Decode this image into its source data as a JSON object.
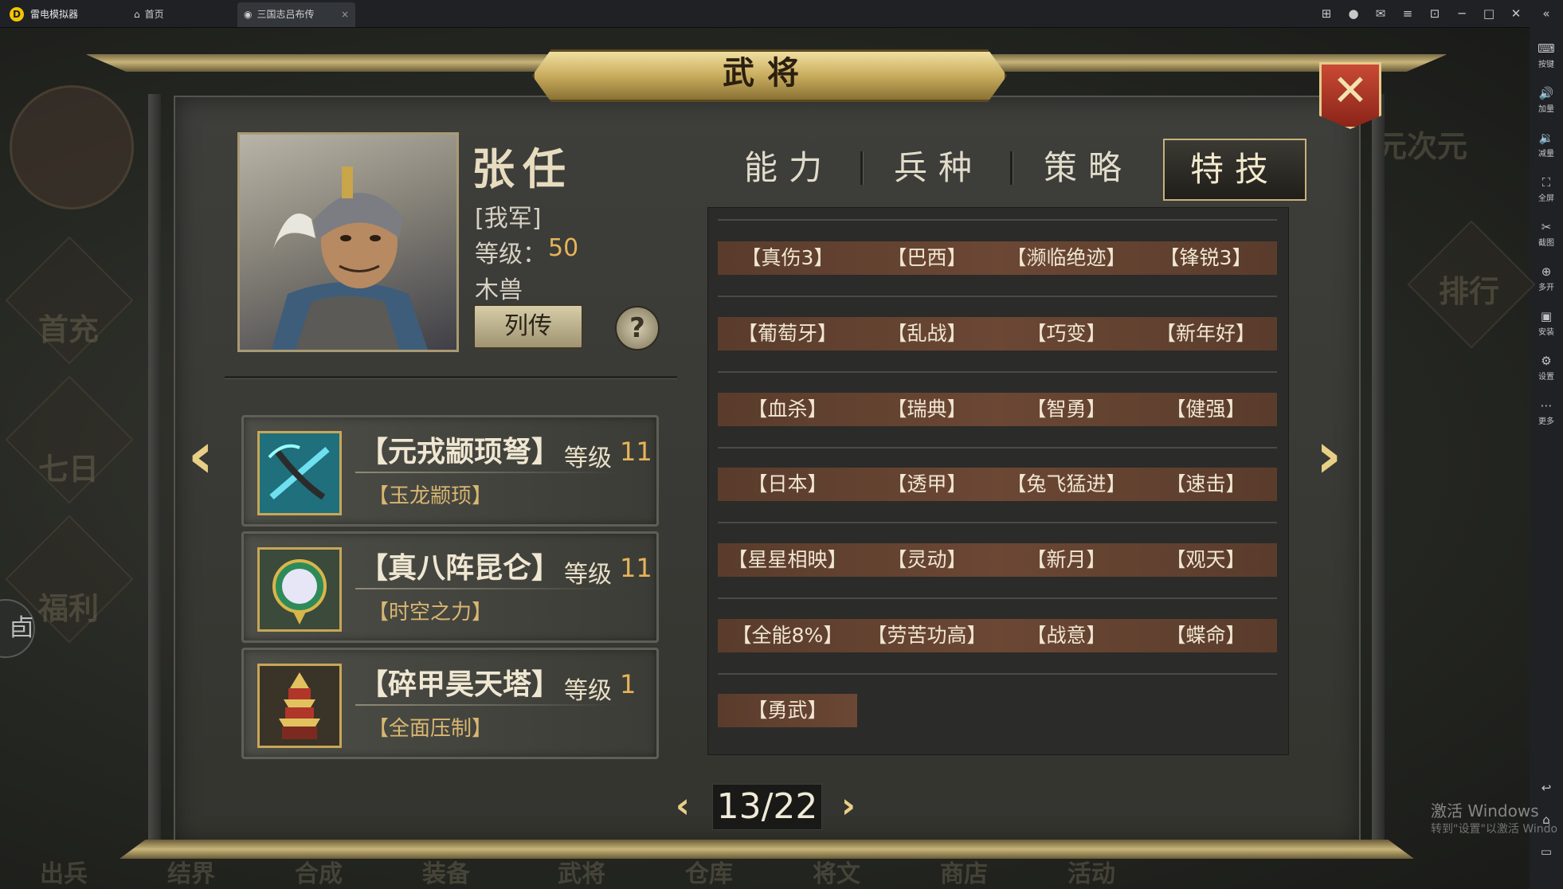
{
  "emulator": {
    "app_name": "雷电模拟器",
    "tabs": [
      {
        "label": "首页"
      },
      {
        "label": "三国志吕布传",
        "close": "×"
      }
    ],
    "sidebar": [
      {
        "icon": "keyboard-icon",
        "label": "按键"
      },
      {
        "icon": "volume-up-icon",
        "label": "加量"
      },
      {
        "icon": "volume-down-icon",
        "label": "减量"
      },
      {
        "icon": "fullscreen-icon",
        "label": "全屏"
      },
      {
        "icon": "scissors-icon",
        "label": "截图"
      },
      {
        "icon": "multi-open-icon",
        "label": "多开"
      },
      {
        "icon": "apk-install-icon",
        "label": "安装"
      },
      {
        "icon": "gear-icon",
        "label": "设置"
      },
      {
        "icon": "more-icon",
        "label": "更多"
      }
    ]
  },
  "background": {
    "left_menu": [
      "首充",
      "七日",
      "福利"
    ],
    "right_menu": [
      "元次元",
      "排行"
    ],
    "bottom_menu": [
      "出兵",
      "结界",
      "合成",
      "装备",
      "武将",
      "仓库",
      "将文",
      "商店",
      "活动"
    ]
  },
  "panel": {
    "title": "武将",
    "close_label": "✕"
  },
  "hero": {
    "name": "张任",
    "faction": "[我军]",
    "level_label": "等级：",
    "level_value": "50",
    "race": "木兽",
    "bio_button": "列传",
    "help_button": "?"
  },
  "equipment": [
    {
      "name": "【元戎颛顼弩】",
      "level_label": "等级",
      "level": "11",
      "skill": "【玉龙颛顼】",
      "icon": "crossbow-icon"
    },
    {
      "name": "【真八阵昆仑】",
      "level_label": "等级",
      "level": "11",
      "skill": "【时空之力】",
      "icon": "mirror-orb-icon"
    },
    {
      "name": "【碎甲昊天塔】",
      "level_label": "等级",
      "level": "1",
      "skill": "【全面压制】",
      "icon": "pagoda-icon"
    }
  ],
  "tabs": [
    {
      "label": "能力",
      "active": false
    },
    {
      "label": "兵种",
      "active": false
    },
    {
      "label": "策略",
      "active": false
    },
    {
      "label": "特技",
      "active": true
    }
  ],
  "skills": [
    [
      "【真伤3】",
      "【巴西】",
      "【濒临绝迹】",
      "【锋锐3】"
    ],
    [
      "【葡萄牙】",
      "【乱战】",
      "【巧变】",
      "【新年好】"
    ],
    [
      "【血杀】",
      "【瑞典】",
      "【智勇】",
      "【健强】"
    ],
    [
      "【日本】",
      "【透甲】",
      "【兔飞猛进】",
      "【速击】"
    ],
    [
      "【星星相映】",
      "【灵动】",
      "【新月】",
      "【观天】"
    ],
    [
      "【全能8%】",
      "【劳苦功高】",
      "【战意】",
      "【蝶命】"
    ],
    [
      "【勇武】"
    ]
  ],
  "pager": {
    "text": "13/22",
    "prev": "‹",
    "next": "›"
  },
  "windows_watermark": {
    "line1": "激活 Windows",
    "line2": "转到\"设置\"以激活 Windo"
  },
  "colors": {
    "accent_gold": "#e6b45a",
    "skill_bg": "#6b4734",
    "active_tab_border": "#c9b27a"
  }
}
